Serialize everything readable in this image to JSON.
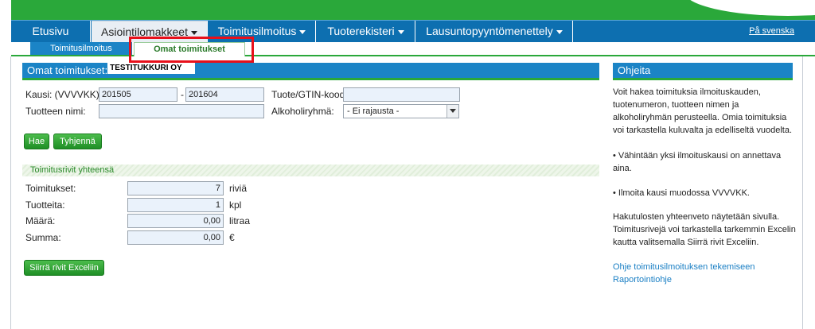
{
  "nav": {
    "items": [
      {
        "label": "Etusivu",
        "dropdown": false
      },
      {
        "label": "Asiointilomakkeet",
        "dropdown": true
      },
      {
        "label": "Toimitusilmoitus",
        "dropdown": true
      },
      {
        "label": "Tuoterekisteri",
        "dropdown": true
      },
      {
        "label": "Lausuntopyyntömenettely",
        "dropdown": true
      }
    ],
    "language_link": "På svenska"
  },
  "subnav": {
    "items": [
      {
        "label": "Toimitusilmoitus"
      },
      {
        "label": "Omat toimitukset"
      }
    ]
  },
  "main": {
    "title": "Omat toimitukset:",
    "company": "TESTITUKKURI OY",
    "form": {
      "kausi_label": "Kausi: (VVVVKK):",
      "kausi_from": "201505",
      "dash": "-",
      "kausi_to": "201604",
      "gtin_label": "Tuote/GTIN-koodi:",
      "gtin_value": "",
      "product_label": "Tuotteen nimi:",
      "product_value": "",
      "alcohol_label": "Alkoholiryhmä:",
      "alcohol_value": "- Ei rajausta -"
    },
    "buttons": {
      "search": "Hae",
      "clear": "Tyhjennä",
      "export": "Siirrä rivit Exceliin"
    },
    "summary": {
      "title": "Toimitusrivit yhteensä",
      "rows": [
        {
          "label": "Toimitukset:",
          "value": "7",
          "unit": "riviä"
        },
        {
          "label": "Tuotteita:",
          "value": "1",
          "unit": "kpl"
        },
        {
          "label": "Määrä:",
          "value": "0,00",
          "unit": "litraa"
        },
        {
          "label": "Summa:",
          "value": "0,00",
          "unit": "€"
        }
      ]
    }
  },
  "help": {
    "title": "Ohjeita",
    "p1": "Voit hakea toimituksia ilmoituskauden, tuotenumeron, tuotteen nimen ja alkoholiryhmän perusteella. Omia toimituksia voi tarkastella kuluvalta ja edelliseltä vuodelta.",
    "p2": "• Vähintään yksi ilmoituskausi on annettava aina.",
    "p3": "• Ilmoita kausi muodossa VVVVKK.",
    "p4": "Hakutulosten yhteenveto näytetään sivulla. Toimitusrivejä voi tarkastella tarkemmin Excelin kautta valitsemalla Siirrä rivit Exceliin.",
    "link1": "Ohje toimitusilmoituksen tekemiseen",
    "link2": "Raportointiohje"
  },
  "colors": {
    "brand_green": "#2aa83a",
    "nav_blue": "#0d6fb0",
    "panel_blue": "#1b84c6",
    "highlight_red": "#e8101a",
    "link_blue": "#1a7fc4"
  }
}
